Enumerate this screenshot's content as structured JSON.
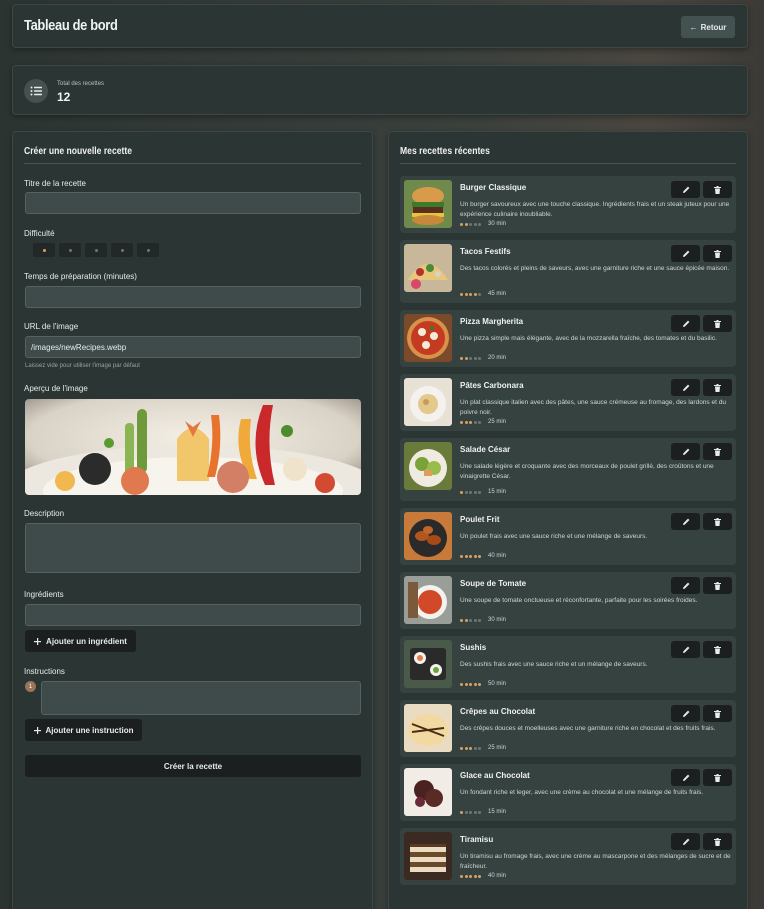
{
  "header": {
    "title": "Tableau de bord",
    "back_label": "Retour",
    "back_arrow": "←"
  },
  "stats": {
    "label": "Total des recettes",
    "value": "12"
  },
  "form": {
    "title": "Créer une nouvelle recette",
    "recipe_title_label": "Titre de la recette",
    "recipe_title_value": "",
    "difficulty_label": "Difficulté",
    "difficulty_value": 1,
    "difficulty_max": 5,
    "prep_time_label": "Temps de préparation (minutes)",
    "prep_time_value": "",
    "image_url_label": "URL de l'image",
    "image_url_value": "/images/newRecipes.webp",
    "image_url_hint": "Laissez vide pour utiliser l'image par défaut",
    "preview_label": "Aperçu de l'image",
    "description_label": "Description",
    "ingredients_label": "Ingrédients",
    "add_ingredient_label": "Ajouter un ingrédient",
    "instructions_label": "Instructions",
    "instruction_number": "1",
    "add_instruction_label": "Ajouter une instruction",
    "submit_label": "Créer la recette"
  },
  "recent": {
    "title": "Mes recettes récentes",
    "recipes": [
      {
        "name": "Burger Classique",
        "description": "Un burger savoureux avec une touche classique. Ingrédients frais et un steak juteux pour une expérience culinaire inoubliable.",
        "rating": 2,
        "time": "30 min",
        "thumb": "burger"
      },
      {
        "name": "Tacos Festifs",
        "description": "Des tacos colorés et pleins de saveurs, avec une garniture riche et une sauce épicée maison.",
        "rating": 4,
        "time": "45 min",
        "thumb": "tacos"
      },
      {
        "name": "Pizza Margherita",
        "description": "Une pizza simple mais élégante, avec de la mozzarella fraîche, des tomates et du basilic.",
        "rating": 2,
        "time": "20 min",
        "thumb": "pizza"
      },
      {
        "name": "Pâtes Carbonara",
        "description": "Un plat classique italien avec des pâtes, une sauce crémeuse au fromage, des lardons et du poivre noir.",
        "rating": 3,
        "time": "25 min",
        "thumb": "pasta"
      },
      {
        "name": "Salade César",
        "description": "Une salade légère et croquante avec des morceaux de poulet grillé, des croûtons et une vinaigrette César.",
        "rating": 1,
        "time": "15 min",
        "thumb": "salad"
      },
      {
        "name": "Poulet Frit",
        "description": "Un poulet frais avec une sauce riche et une mélange de saveurs.",
        "rating": 5,
        "time": "40 min",
        "thumb": "chicken"
      },
      {
        "name": "Soupe de Tomate",
        "description": "Une soupe de tomate onctueuse et réconfortante, parfaite pour les soirées froides.",
        "rating": 2,
        "time": "30 min",
        "thumb": "soup"
      },
      {
        "name": "Sushis",
        "description": "Des sushis frais avec une sauce riche et un mélange de saveurs.",
        "rating": 5,
        "time": "50 min",
        "thumb": "sushi"
      },
      {
        "name": "Crêpes au Chocolat",
        "description": "Des crêpes douces et moelleuses avec une garniture riche en chocolat et des fruits frais.",
        "rating": 3,
        "time": "25 min",
        "thumb": "crepes"
      },
      {
        "name": "Glace au Chocolat",
        "description": "Un fondant riche et leger, avec une crème au chocolat et une mélange de fruits frais.",
        "rating": 1,
        "time": "15 min",
        "thumb": "icecream"
      },
      {
        "name": "Tiramisu",
        "description": "Un tiramisu au fromage frais, avec une crème au mascarpone et des mélanges de sucre et de fraîcheur.",
        "rating": 5,
        "time": "40 min",
        "thumb": "tiramisu"
      }
    ]
  },
  "colors": {
    "star_on": "#d9a061",
    "star_off": "#6e7775",
    "panel": "#2b3534",
    "card": "#354240",
    "input": "#3e4b4a"
  },
  "icons": {
    "stats": "list-icon",
    "edit": "pencil-icon",
    "delete": "trash-icon",
    "add": "plus-icon"
  }
}
